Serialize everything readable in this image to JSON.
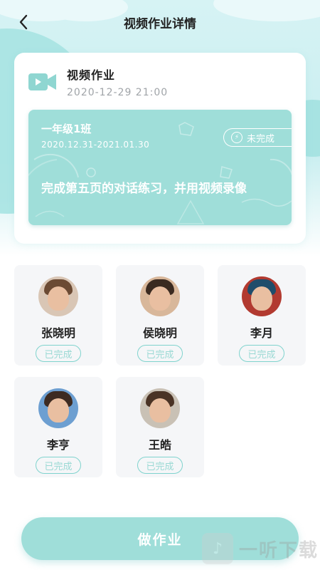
{
  "header": {
    "title": "视频作业详情"
  },
  "homework": {
    "type_label": "视频作业",
    "created_at": "2020-12-29 21:00",
    "class_name": "一年级1班",
    "date_range": "2020.12.31-2021.01.30",
    "status": "未完成",
    "description": "完成第五页的对话练习，并用视频录像"
  },
  "students": [
    {
      "name": "张晓明",
      "status": "已完成",
      "hair_color": "#6b4a33",
      "bg_color": "#d9c6b5"
    },
    {
      "name": "侯晓明",
      "status": "已完成",
      "hair_color": "#3a2a20",
      "bg_color": "#d8b79a"
    },
    {
      "name": "李月",
      "status": "已完成",
      "hair_color": "#1f4d6b",
      "bg_color": "#b23a30"
    },
    {
      "name": "李亨",
      "status": "已完成",
      "hair_color": "#3d2b22",
      "bg_color": "#6d9fd1"
    },
    {
      "name": "王皓",
      "status": "已完成",
      "hair_color": "#4a3325",
      "bg_color": "#c9c1b5"
    }
  ],
  "actions": {
    "submit_label": "做作业"
  },
  "watermark": {
    "text": "一听下载"
  },
  "colors": {
    "accent": "#9fded9",
    "badge_border": "#7fd3cd",
    "card_bg": "#f5f6f8"
  }
}
